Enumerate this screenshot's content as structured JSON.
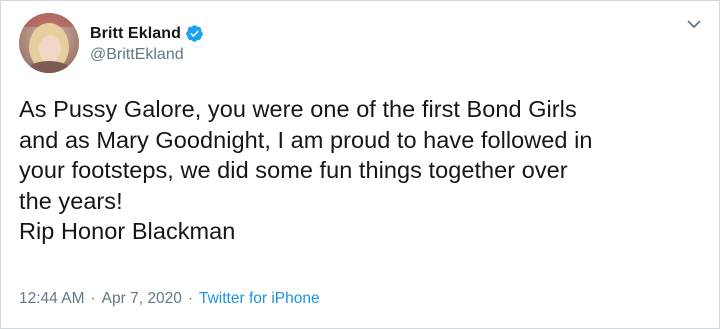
{
  "tweet": {
    "display_name": "Britt Ekland",
    "handle": "@BrittEkland",
    "text": "As Pussy Galore, you were one of the first Bond Girls\nand as Mary Goodnight, I am proud to have followed in\nyour footsteps, we did some fun things together over\nthe years!\nRip Honor Blackman",
    "time": "12:44 AM",
    "separator": "·",
    "date": "Apr 7, 2020",
    "source": "Twitter for iPhone"
  },
  "icons": {
    "verified": "verified-badge-icon",
    "menu": "chevron-down-icon"
  },
  "colors": {
    "text": "#14171a",
    "secondary": "#657786",
    "link": "#1b95e0",
    "verified": "#1da1f2"
  }
}
